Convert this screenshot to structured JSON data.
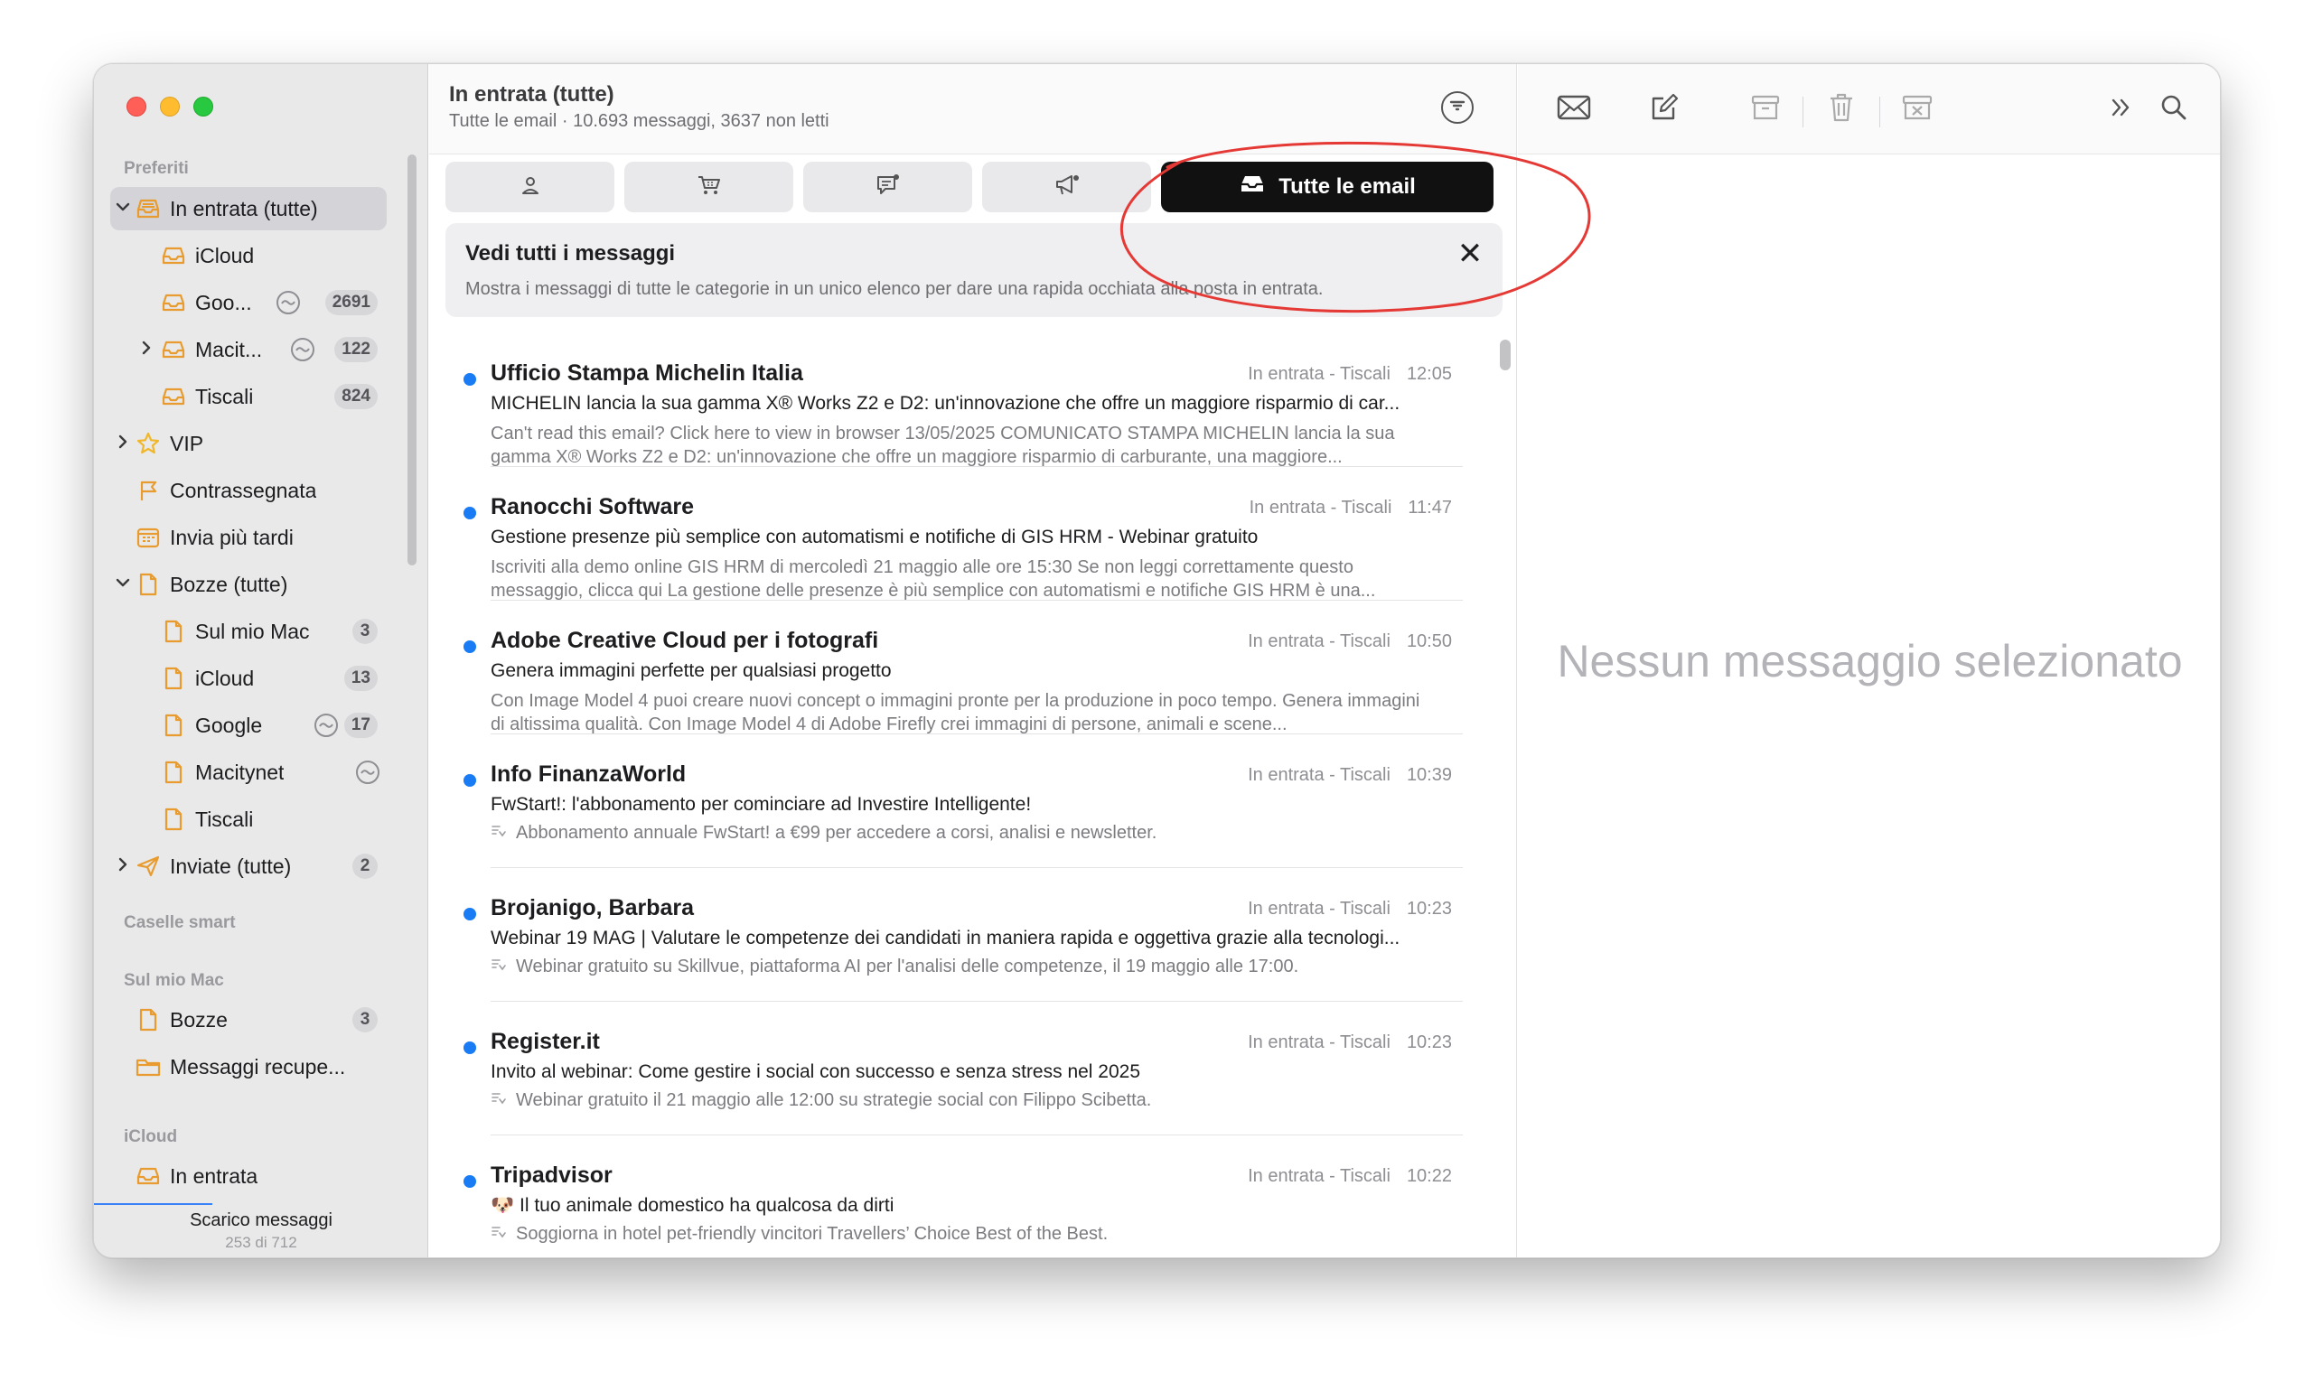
{
  "sidebar": {
    "sections": {
      "favorites": "Preferiti",
      "smart": "Caselle smart",
      "on_mac": "Sul mio Mac",
      "icloud": "iCloud"
    },
    "items": [
      {
        "label": "In entrata (tutte)",
        "badge": ""
      },
      {
        "label": "iCloud",
        "badge": ""
      },
      {
        "label": "Goo...",
        "badge": "2691"
      },
      {
        "label": "Macit...",
        "badge": "122"
      },
      {
        "label": "Tiscali",
        "badge": "824"
      },
      {
        "label": "VIP",
        "badge": ""
      },
      {
        "label": "Contrassegnata",
        "badge": ""
      },
      {
        "label": "Invia più tardi",
        "badge": ""
      },
      {
        "label": "Bozze (tutte)",
        "badge": ""
      },
      {
        "label": "Sul mio Mac",
        "badge": "3"
      },
      {
        "label": "iCloud",
        "badge": "13"
      },
      {
        "label": "Google",
        "badge": "17"
      },
      {
        "label": "Macitynet",
        "badge": ""
      },
      {
        "label": "Tiscali",
        "badge": ""
      },
      {
        "label": "Inviate (tutte)",
        "badge": "2"
      },
      {
        "label": "Bozze",
        "badge": "3"
      },
      {
        "label": "Messaggi recupe...",
        "badge": ""
      },
      {
        "label": "In entrata",
        "badge": ""
      }
    ],
    "footer": {
      "status": "Scarico messaggi",
      "progress_text": "253 di 712",
      "progress": 0.355
    }
  },
  "list": {
    "title": "In entrata (tutte)",
    "subtitle": "Tutte le email · 10.693 messaggi, 3637 non letti",
    "tabs": {
      "active_label": "Tutte le email"
    },
    "banner": {
      "title": "Vedi tutti i messaggi",
      "text": "Mostra i messaggi di tutte le categorie in un unico elenco per dare una rapida occhiata alla posta in entrata.",
      "close": "✕"
    },
    "messages": [
      {
        "sender": "Ufficio Stampa Michelin Italia",
        "mailbox": "In entrata - Tiscali",
        "time": "12:05",
        "subject": "MICHELIN lancia la sua gamma X® Works Z2 e D2:  un'innovazione che offre un maggiore risparmio di car...",
        "preview": "Can't read this email? Click here to view in browser 13/05/2025 COMUNICATO STAMPA MICHELIN lancia la sua gamma X® Works Z2 e D2: un'innovazione che offre un maggiore risparmio di carburante, una maggiore..."
      },
      {
        "sender": "Ranocchi Software",
        "mailbox": "In entrata - Tiscali",
        "time": "11:47",
        "subject": "Gestione presenze più semplice con automatismi e notifiche di GIS HRM - Webinar gratuito",
        "preview": "Iscriviti alla demo online GIS HRM di mercoledì 21 maggio alle ore 15:30 Se non leggi correttamente questo messaggio, clicca qui La gestione delle presenze è più semplice con automatismi e notifiche GIS HRM è una..."
      },
      {
        "sender": "Adobe Creative Cloud per i fotografi",
        "mailbox": "In entrata - Tiscali",
        "time": "10:50",
        "subject": "Genera immagini perfette per qualsiasi progetto",
        "preview": "Con Image Model 4 puoi creare nuovi concept o immagini pronte per la produzione in poco tempo. Genera immagini di altissima qualità. Con Image Model 4 di Adobe Firefly crei immagini di persone, animali e scene..."
      },
      {
        "sender": "Info FinanzaWorld",
        "mailbox": "In entrata - Tiscali",
        "time": "10:39",
        "subject": "FwStart!: l'abbonamento per cominciare ad Investire Intelligente!",
        "summary": "Abbonamento annuale FwStart! a €99 per accedere a corsi, analisi e newsletter."
      },
      {
        "sender": "Brojanigo, Barbara",
        "mailbox": "In entrata - Tiscali",
        "time": "10:23",
        "subject": "Webinar 19 MAG | Valutare le competenze dei candidati in maniera rapida e oggettiva grazie alla tecnologi...",
        "summary": "Webinar gratuito su Skillvue, piattaforma AI per l'analisi delle competenze, il 19 maggio alle 17:00."
      },
      {
        "sender": "Register.it",
        "mailbox": "In entrata - Tiscali",
        "time": "10:23",
        "subject": "Invito al webinar: Come gestire i social con successo e senza stress nel 2025",
        "summary": "Webinar gratuito il 21 maggio alle 12:00 su strategie social con Filippo Scibetta."
      },
      {
        "sender": "Tripadvisor",
        "mailbox": "In entrata - Tiscali",
        "time": "10:22",
        "subject": "🐶 Il tuo animale domestico ha qualcosa da dirti",
        "summary": "Soggiorna in hotel pet-friendly vincitori Travellers’ Choice Best of the Best."
      }
    ]
  },
  "viewer": {
    "empty_text": "Nessun messaggio selezionato"
  },
  "colors": {
    "unread_dot": "#1a7cf5",
    "annotation": "#e53935",
    "active_tab": "#111111"
  }
}
